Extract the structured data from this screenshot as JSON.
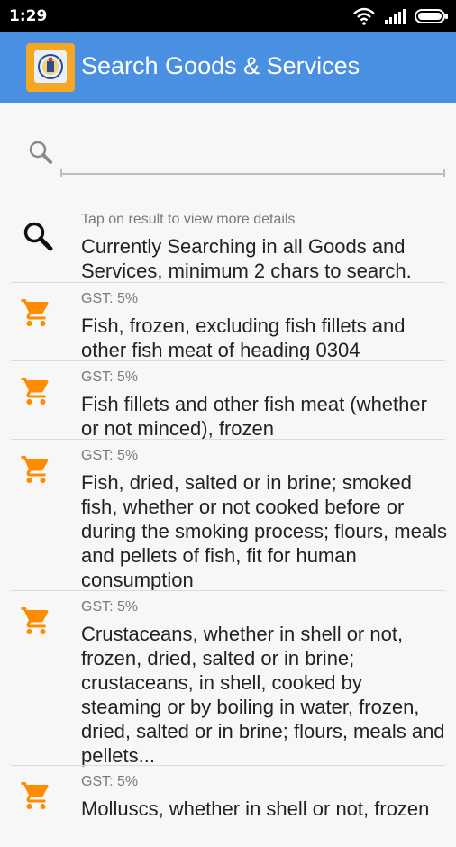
{
  "status_bar": {
    "time": "1:29"
  },
  "app_bar": {
    "title": "Search Goods & Services"
  },
  "search": {
    "placeholder": "",
    "value": ""
  },
  "info": {
    "hint": "Tap on result to view more details",
    "message": "Currently Searching in all Goods and Services, minimum 2 chars to search."
  },
  "results": [
    {
      "gst": "GST: 5%",
      "description": "Fish, frozen, excluding fish fillets and other fish meat of heading 0304"
    },
    {
      "gst": "GST: 5%",
      "description": "Fish fillets and other fish meat (whether or not minced), frozen"
    },
    {
      "gst": "GST: 5%",
      "description": "Fish, dried, salted or in brine; smoked fish, whether or not cooked before or during the smoking process; flours, meals and pellets of fish, fit for human consumption"
    },
    {
      "gst": "GST: 5%",
      "description": "Crustaceans, whether in shell or not, frozen, dried, salted or in brine; crustaceans, in shell, cooked by steaming or by boiling in water, frozen, dried, salted or in brine; flours, meals and pellets..."
    },
    {
      "gst": "GST: 5%",
      "description": "Molluscs, whether in shell or not, frozen"
    }
  ],
  "colors": {
    "app_bar": "#4a90e2",
    "accent": "#f5a623",
    "cart": "#ff8c00"
  },
  "icons": {
    "wifi": "wifi-icon",
    "signal": "signal-icon",
    "battery": "battery-icon",
    "logo": "app-logo-icon",
    "search": "search-icon",
    "cart": "cart-icon"
  }
}
